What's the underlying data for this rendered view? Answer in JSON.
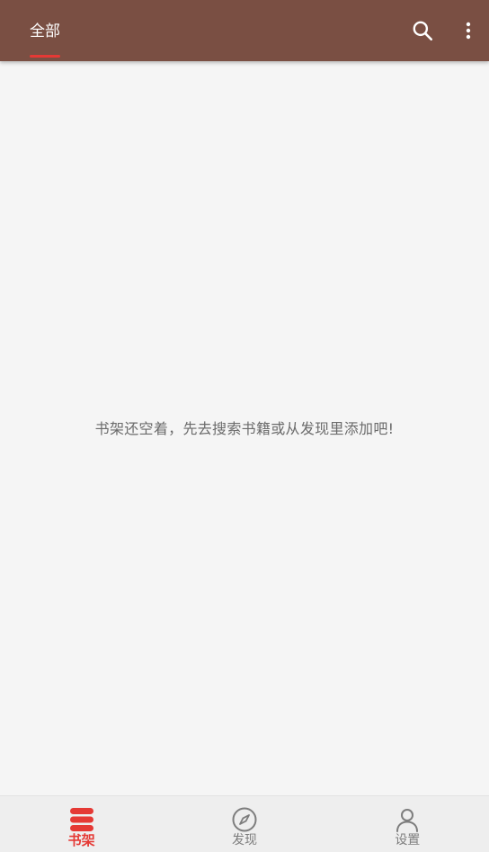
{
  "header": {
    "tabs": [
      {
        "label": "全部",
        "active": true
      }
    ],
    "search_icon": "search-icon",
    "more_icon": "more-vertical-icon"
  },
  "main": {
    "empty_message": "书架还空着，先去搜索书籍或从发现里添加吧!"
  },
  "bottom_nav": {
    "items": [
      {
        "label": "书架",
        "icon": "bookshelf-icon",
        "active": true
      },
      {
        "label": "发现",
        "icon": "compass-icon",
        "active": false
      },
      {
        "label": "设置",
        "icon": "person-icon",
        "active": false
      }
    ]
  },
  "colors": {
    "toolbar": "#7a4f43",
    "accent": "#e53935",
    "background": "#f5f5f5",
    "nav_background": "#eeeeee",
    "inactive": "#7d7d7d"
  }
}
